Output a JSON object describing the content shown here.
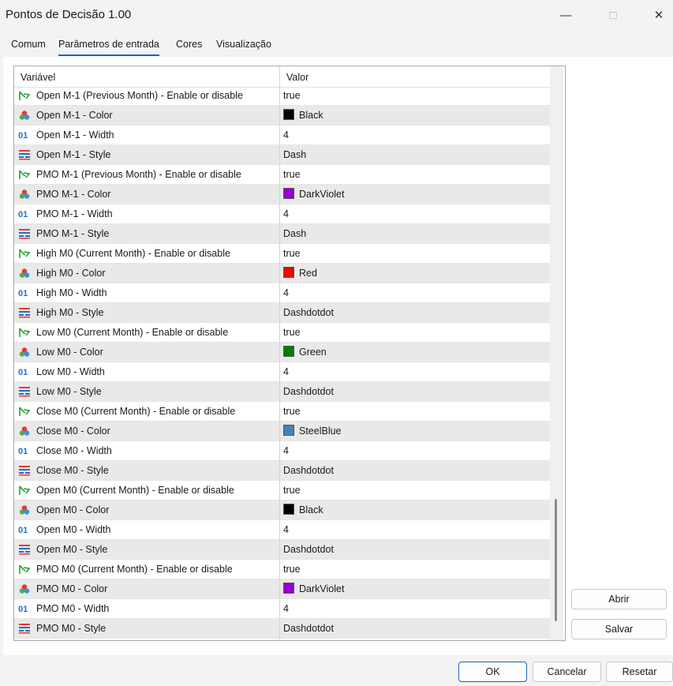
{
  "window": {
    "title": "Pontos de Decisão 1.00"
  },
  "tabs": [
    {
      "label": "Comum"
    },
    {
      "label": "Parâmetros de entrada"
    },
    {
      "label": "Cores"
    },
    {
      "label": "Visualização"
    }
  ],
  "grid": {
    "col_variable": "Variável",
    "col_value": "Valor",
    "rows": [
      {
        "icon": "toggle-arrow-icon",
        "name": "Open M-1 (Previous Month) - Enable or disable",
        "value": "true"
      },
      {
        "icon": "color-icon",
        "name": "Open M-1 - Color",
        "value": "Black",
        "swatch": "#000000"
      },
      {
        "icon": "number-icon",
        "name": "Open M-1 - Width",
        "value": "4"
      },
      {
        "icon": "line-style-icon",
        "name": "Open M-1 - Style",
        "value": "Dash"
      },
      {
        "icon": "toggle-arrow-icon",
        "name": "PMO M-1 (Previous Month) - Enable or disable",
        "value": "true"
      },
      {
        "icon": "color-icon",
        "name": "PMO M-1 - Color",
        "value": "DarkViolet",
        "swatch": "#9400d3"
      },
      {
        "icon": "number-icon",
        "name": "PMO M-1 - Width",
        "value": "4"
      },
      {
        "icon": "line-style-icon",
        "name": "PMO M-1 - Style",
        "value": "Dash"
      },
      {
        "icon": "toggle-arrow-icon",
        "name": "High M0 (Current Month) - Enable or disable",
        "value": "true"
      },
      {
        "icon": "color-icon",
        "name": "High M0 - Color",
        "value": "Red",
        "swatch": "#ff0000"
      },
      {
        "icon": "number-icon",
        "name": "High M0 - Width",
        "value": "4"
      },
      {
        "icon": "line-style-icon",
        "name": "High M0 - Style",
        "value": "Dashdotdot"
      },
      {
        "icon": "toggle-arrow-icon",
        "name": "Low M0 (Current Month) - Enable or disable",
        "value": "true"
      },
      {
        "icon": "color-icon",
        "name": "Low M0 - Color",
        "value": "Green",
        "swatch": "#008000"
      },
      {
        "icon": "number-icon",
        "name": "Low M0 - Width",
        "value": "4"
      },
      {
        "icon": "line-style-icon",
        "name": "Low M0 - Style",
        "value": "Dashdotdot"
      },
      {
        "icon": "toggle-arrow-icon",
        "name": "Close M0 (Current Month) - Enable or disable",
        "value": "true"
      },
      {
        "icon": "color-icon",
        "name": "Close M0 - Color",
        "value": "SteelBlue",
        "swatch": "#4682b4"
      },
      {
        "icon": "number-icon",
        "name": "Close M0 - Width",
        "value": "4"
      },
      {
        "icon": "line-style-icon",
        "name": "Close M0 - Style",
        "value": "Dashdotdot"
      },
      {
        "icon": "toggle-arrow-icon",
        "name": "Open M0 (Current Month) - Enable or disable",
        "value": "true"
      },
      {
        "icon": "color-icon",
        "name": "Open M0 - Color",
        "value": "Black",
        "swatch": "#000000"
      },
      {
        "icon": "number-icon",
        "name": "Open M0 - Width",
        "value": "4"
      },
      {
        "icon": "line-style-icon",
        "name": "Open M0 - Style",
        "value": "Dashdotdot"
      },
      {
        "icon": "toggle-arrow-icon",
        "name": "PMO M0 (Current Month) - Enable or disable",
        "value": "true"
      },
      {
        "icon": "color-icon",
        "name": "PMO M0 - Color",
        "value": "DarkViolet",
        "swatch": "#9400d3"
      },
      {
        "icon": "number-icon",
        "name": "PMO M0 - Width",
        "value": "4"
      },
      {
        "icon": "line-style-icon",
        "name": "PMO M0 - Style",
        "value": "Dashdotdot"
      }
    ]
  },
  "side_buttons": {
    "open": "Abrir",
    "save": "Salvar"
  },
  "footer": {
    "ok": "OK",
    "cancel": "Cancelar",
    "reset": "Resetar"
  },
  "colors": {
    "accent": "#1b62c0"
  }
}
